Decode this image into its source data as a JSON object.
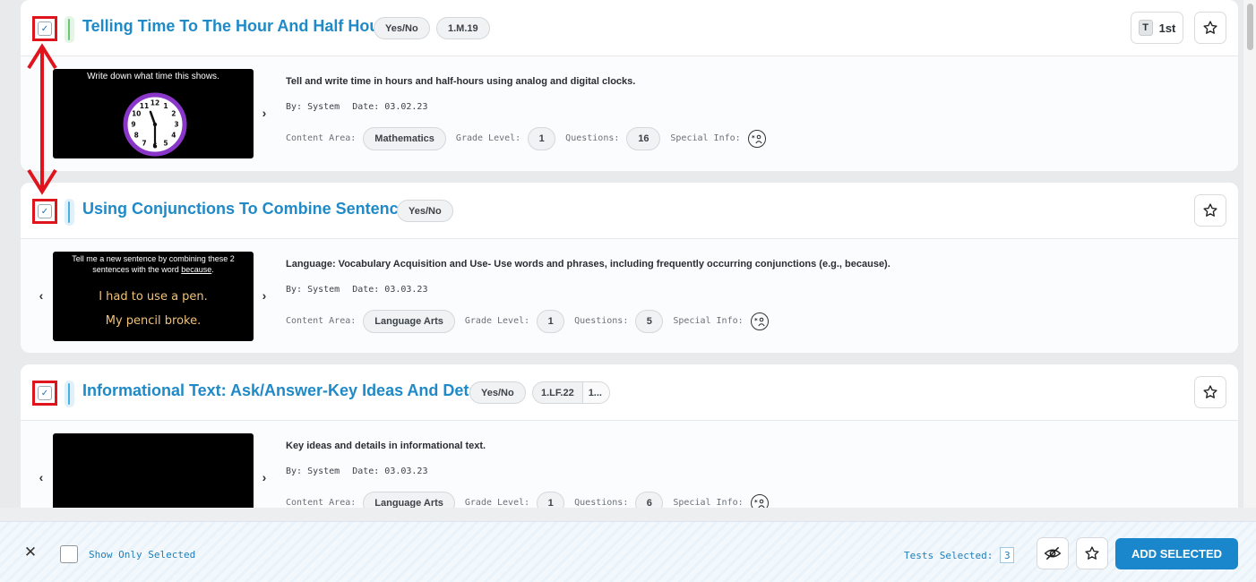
{
  "cards": [
    {
      "title": "Telling Time To The Hour And Half Hour",
      "tags": [
        "Yes/No",
        "1.M.19"
      ],
      "grade_badge": {
        "letter": "T",
        "label": "1st"
      },
      "thumb_text": "Write down what time this shows.",
      "description": "Tell and write time in hours and half-hours using analog and digital clocks.",
      "by_label": "By:",
      "by": "System",
      "date_label": "Date:",
      "date": "03.02.23",
      "content_area_label": "Content Area:",
      "content_area": "Mathematics",
      "grade_level_label": "Grade Level:",
      "grade_level": "1",
      "questions_label": "Questions:",
      "questions": "16",
      "special_info_label": "Special Info:"
    },
    {
      "title": "Using Conjunctions To Combine Sentences",
      "tags": [
        "Yes/No"
      ],
      "thumb_line1": "Tell me a new sentence by combining these 2",
      "thumb_line2a": "sentences with the word ",
      "thumb_line2b": "because",
      "thumb_line2c": ".",
      "thumb_sentence1": "I had to use a pen.",
      "thumb_sentence2": "My pencil broke.",
      "description": "Language: Vocabulary Acquisition and Use- Use words and phrases, including frequently occurring conjunctions (e.g., because).",
      "by_label": "By:",
      "by": "System",
      "date_label": "Date:",
      "date": "03.03.23",
      "content_area_label": "Content Area:",
      "content_area": "Language Arts",
      "grade_level_label": "Grade Level:",
      "grade_level": "1",
      "questions_label": "Questions:",
      "questions": "5",
      "special_info_label": "Special Info:"
    },
    {
      "title": "Informational Text: Ask/Answer-Key Ideas And Detail",
      "tags": [
        "Yes/No"
      ],
      "standard_tags": [
        "1.LF.22",
        "1..."
      ],
      "description": "Key ideas and details in informational text.",
      "by_label": "By:",
      "by": "System",
      "date_label": "Date:",
      "date": "03.03.23",
      "content_area_label": "Content Area:",
      "content_area": "Language Arts",
      "grade_level_label": "Grade Level:",
      "grade_level": "1",
      "questions_label": "Questions:",
      "questions": "6",
      "special_info_label": "Special Info:"
    }
  ],
  "footer": {
    "close_glyph": "✕",
    "show_only_selected": "Show Only Selected",
    "tests_selected_label": "Tests Selected:",
    "tests_selected_count": "3",
    "add_selected_label": "ADD SELECTED"
  },
  "glyphs": {
    "check": "✓",
    "prev": "‹",
    "next": "›",
    "clock_numbers": [
      "12",
      "1",
      "2",
      "3",
      "4",
      "5",
      "6",
      "7",
      "8",
      "9",
      "10",
      "11"
    ]
  },
  "colors": {
    "accent": "#1a87cc",
    "title": "#1f8ac7",
    "highlight": "#e0141c"
  }
}
